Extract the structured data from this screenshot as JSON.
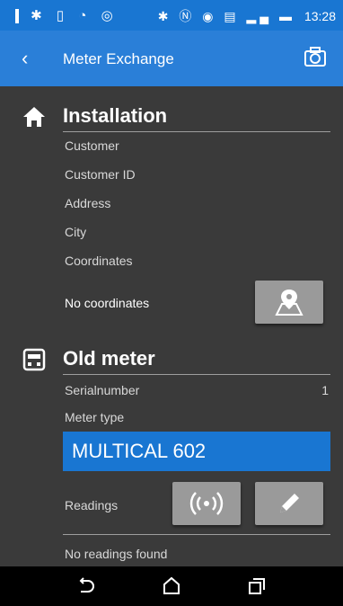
{
  "status_bar": {
    "left_icons": [
      "usb-icon",
      "bluetooth-icon",
      "screen-icon",
      "wifi-icon",
      "alarm-icon"
    ],
    "right_icons": [
      "bluetooth-icon",
      "nfc-icon",
      "sync-icon",
      "sim-icon",
      "signal-icon",
      "battery-icon"
    ],
    "time": "13:28"
  },
  "app_bar": {
    "title": "Meter Exchange",
    "back_icon": "back-chevron-icon",
    "action_icon": "camera-icon"
  },
  "installation": {
    "title": "Installation",
    "icon": "home-icon",
    "fields": [
      "Customer",
      "Customer ID",
      "Address",
      "City",
      "Coordinates"
    ],
    "coordinates_value": "No coordinates",
    "map_button_icon": "map-pin-icon"
  },
  "old_meter": {
    "title": "Old meter",
    "icon": "meter-icon",
    "serial_label": "Serialnumber",
    "serial_value": "1",
    "meter_type_label": "Meter type",
    "meter_type_value": "MULTICAL 602",
    "readings_label": "Readings",
    "read_button_icon": "radio-signal-icon",
    "edit_button_icon": "pencil-icon",
    "readings_empty": "No readings found"
  },
  "nav_bar": {
    "buttons": [
      "back-nav-icon",
      "home-nav-icon",
      "recents-nav-icon"
    ]
  },
  "colors": {
    "primary": "#2a7fd8",
    "background": "#3a3a3a",
    "button": "#9a9a9a"
  }
}
